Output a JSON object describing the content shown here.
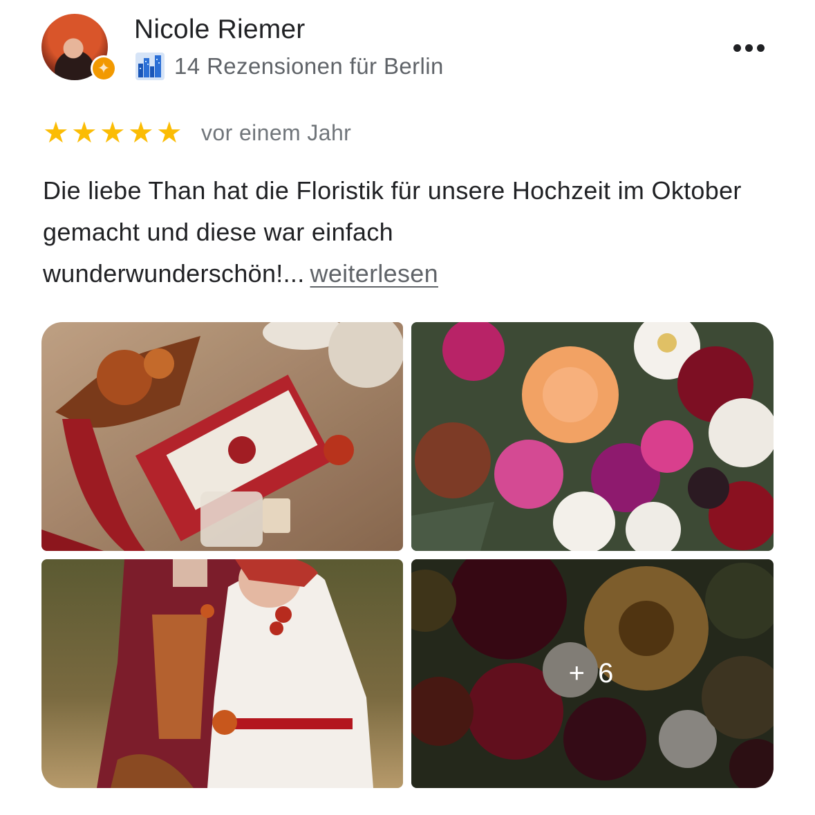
{
  "reviewer": {
    "name": "Nicole Riemer",
    "reviews_label": "14 Rezensionen für Berlin",
    "badge_icon": "local-guide-star-icon",
    "city_icon": "city-skyline-icon"
  },
  "menu": {
    "icon": "more-horizontal-icon"
  },
  "review": {
    "rating": 5,
    "rating_max": 5,
    "star_glyph": "★",
    "date": "vor einem Jahr",
    "text": "Die liebe Than hat die Floristik für unsere Hochzeit im Oktober gemacht und diese war einfach wunderwunderschön!...",
    "read_more": "weiterlesen"
  },
  "photos": {
    "items": [
      {
        "subject": "wedding-invitation-stationery"
      },
      {
        "subject": "flower-bouquet-closeup"
      },
      {
        "subject": "bride-and-groom"
      },
      {
        "subject": "autumn-bouquet"
      }
    ],
    "more_label": "+ 6"
  },
  "colors": {
    "star": "#fbbc04",
    "badge": "#f29900",
    "text_primary": "#202124",
    "text_secondary": "#5f6368"
  }
}
